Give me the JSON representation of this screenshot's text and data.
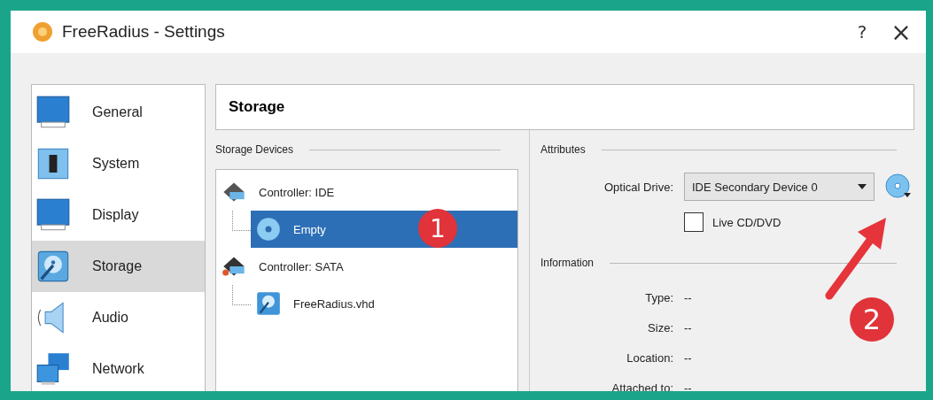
{
  "window": {
    "title": "FreeRadius - Settings",
    "help": "?",
    "close": "×"
  },
  "sidebar": {
    "items": [
      {
        "label": "General",
        "kind": "general",
        "selected": false
      },
      {
        "label": "System",
        "kind": "system",
        "selected": false
      },
      {
        "label": "Display",
        "kind": "display",
        "selected": false
      },
      {
        "label": "Storage",
        "kind": "storage",
        "selected": true
      },
      {
        "label": "Audio",
        "kind": "audio",
        "selected": false
      },
      {
        "label": "Network",
        "kind": "network",
        "selected": false
      }
    ]
  },
  "header": "Storage",
  "storage_devices": {
    "title": "Storage Devices",
    "tree": [
      {
        "label": "Controller: IDE",
        "kind": "ide",
        "selected": false,
        "children": [
          {
            "label": "Empty",
            "kind": "optical",
            "selected": true
          }
        ]
      },
      {
        "label": "Controller: SATA",
        "kind": "sata",
        "selected": false,
        "children": [
          {
            "label": "FreeRadius.vhd",
            "kind": "disk",
            "selected": false
          }
        ]
      }
    ]
  },
  "attributes": {
    "title": "Attributes",
    "optical_drive": {
      "label": "Optical Drive:",
      "value": "IDE Secondary Device 0"
    },
    "live_cd": {
      "label": "Live CD/DVD",
      "checked": false
    }
  },
  "information": {
    "title": "Information",
    "rows": [
      {
        "label": "Type:",
        "value": "--"
      },
      {
        "label": "Size:",
        "value": "--"
      },
      {
        "label": "Location:",
        "value": "--"
      },
      {
        "label": "Attached to:",
        "value": "--"
      }
    ]
  },
  "annotations": [
    {
      "number": "1"
    },
    {
      "number": "2"
    }
  ]
}
